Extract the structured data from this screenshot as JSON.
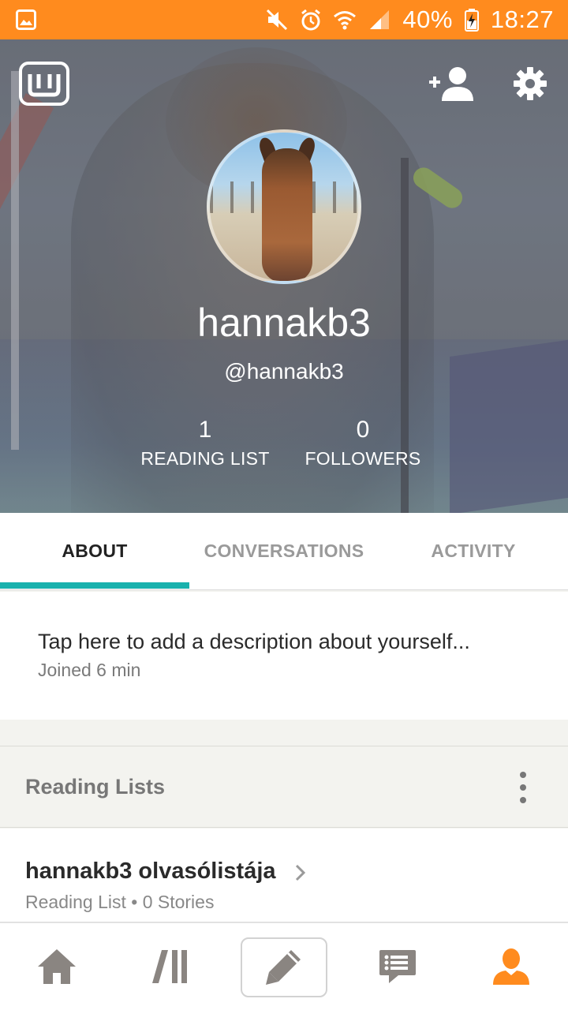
{
  "status_bar": {
    "battery": "40%",
    "time": "18:27",
    "colors": {
      "background": "#ff8b1e"
    }
  },
  "profile": {
    "display_name": "hannakb3",
    "username": "@hannakb3",
    "stats": {
      "reading_list_count": "1",
      "reading_list_label": "READING LIST",
      "followers_count": "0",
      "followers_label": "FOLLOWERS"
    }
  },
  "tabs": [
    {
      "label": "ABOUT",
      "active": true
    },
    {
      "label": "CONVERSATIONS",
      "active": false
    },
    {
      "label": "ACTIVITY",
      "active": false
    }
  ],
  "about": {
    "description_placeholder": "Tap here to add a description about yourself...",
    "joined": "Joined 6 min"
  },
  "reading_lists": {
    "title": "Reading Lists",
    "items": [
      {
        "name": "hannakb3 olvasólistája",
        "meta": "Reading List • 0 Stories"
      }
    ]
  },
  "bottom_nav": {
    "items": [
      "home-icon",
      "library-icon",
      "write-icon",
      "messages-icon",
      "profile-icon"
    ],
    "active_color": "#ff8b1e",
    "inactive_color": "#8a8581"
  },
  "accent_color": "#19b1ad"
}
